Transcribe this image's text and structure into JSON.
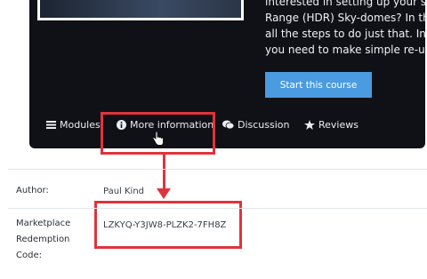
{
  "course": {
    "description_lines": [
      "interested in setting up your sce",
      "Range (HDR) Sky-domes? In this",
      "all the steps to do just that. In no",
      "you need to make simple re-usab"
    ],
    "start_button": "Start this course"
  },
  "tabs": [
    {
      "label": "Modules",
      "icon": "list-icon"
    },
    {
      "label": "More information",
      "icon": "info-icon"
    },
    {
      "label": "Discussion",
      "icon": "chat-icon"
    },
    {
      "label": "Reviews",
      "icon": "star-icon"
    }
  ],
  "details": {
    "author_label": "Author:",
    "author_value": "Paul Kind",
    "code_label_lines": [
      "Marketplace",
      "Redemption",
      "Code:"
    ],
    "code_value": "LZKYQ-Y3JW8-PLZK2-7FH8Z"
  },
  "colors": {
    "hero_bg": "#0f1116",
    "accent_button": "#4a9be0",
    "callout": "#e0333c"
  }
}
